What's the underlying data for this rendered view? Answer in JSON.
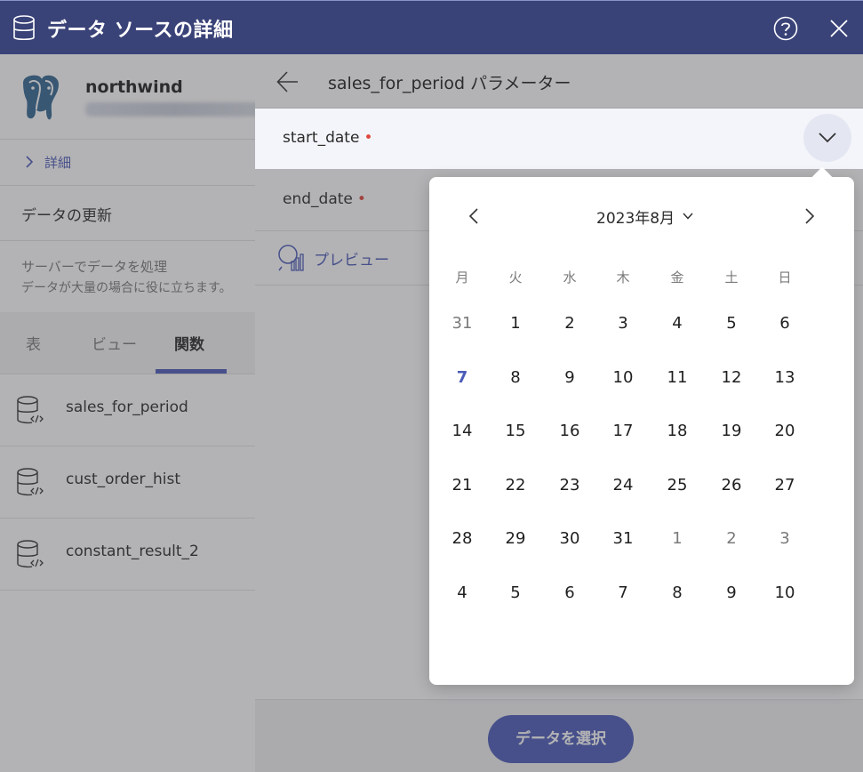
{
  "window": {
    "title": "データ ソースの詳細"
  },
  "connection": {
    "name": "northwind"
  },
  "sidebar": {
    "details_label": "詳細",
    "refresh_label": "データの更新",
    "server_line1": "サーバーでデータを処理",
    "server_line2": "データが大量の場合に役に立ちます。",
    "tabs": [
      {
        "label": "表"
      },
      {
        "label": "ビュー"
      },
      {
        "label": "関数"
      }
    ],
    "functions": [
      {
        "label": "sales_for_period"
      },
      {
        "label": "cust_order_hist"
      },
      {
        "label": "constant_result_2"
      }
    ]
  },
  "panel": {
    "title": "sales_for_period パラメーター",
    "params": [
      {
        "label": "start_date",
        "required": "•"
      },
      {
        "label": "end_date",
        "required": "•"
      }
    ],
    "preview_label": "プレビュー",
    "select_button": "データを選択"
  },
  "calendar": {
    "month_label": "2023年8月",
    "weekdays": [
      "月",
      "火",
      "水",
      "木",
      "金",
      "土",
      "日"
    ],
    "weeks": [
      [
        "31",
        "1",
        "2",
        "3",
        "4",
        "5",
        "6"
      ],
      [
        "7",
        "8",
        "9",
        "10",
        "11",
        "12",
        "13"
      ],
      [
        "14",
        "15",
        "16",
        "17",
        "18",
        "19",
        "20"
      ],
      [
        "21",
        "22",
        "23",
        "24",
        "25",
        "26",
        "27"
      ],
      [
        "28",
        "29",
        "30",
        "31",
        "1",
        "2",
        "3"
      ],
      [
        "4",
        "5",
        "6",
        "7",
        "8",
        "9",
        "10"
      ]
    ]
  },
  "colors": {
    "titlebar": "#3a4378",
    "accent": "#4b5bb8",
    "required": "#e0473f"
  }
}
